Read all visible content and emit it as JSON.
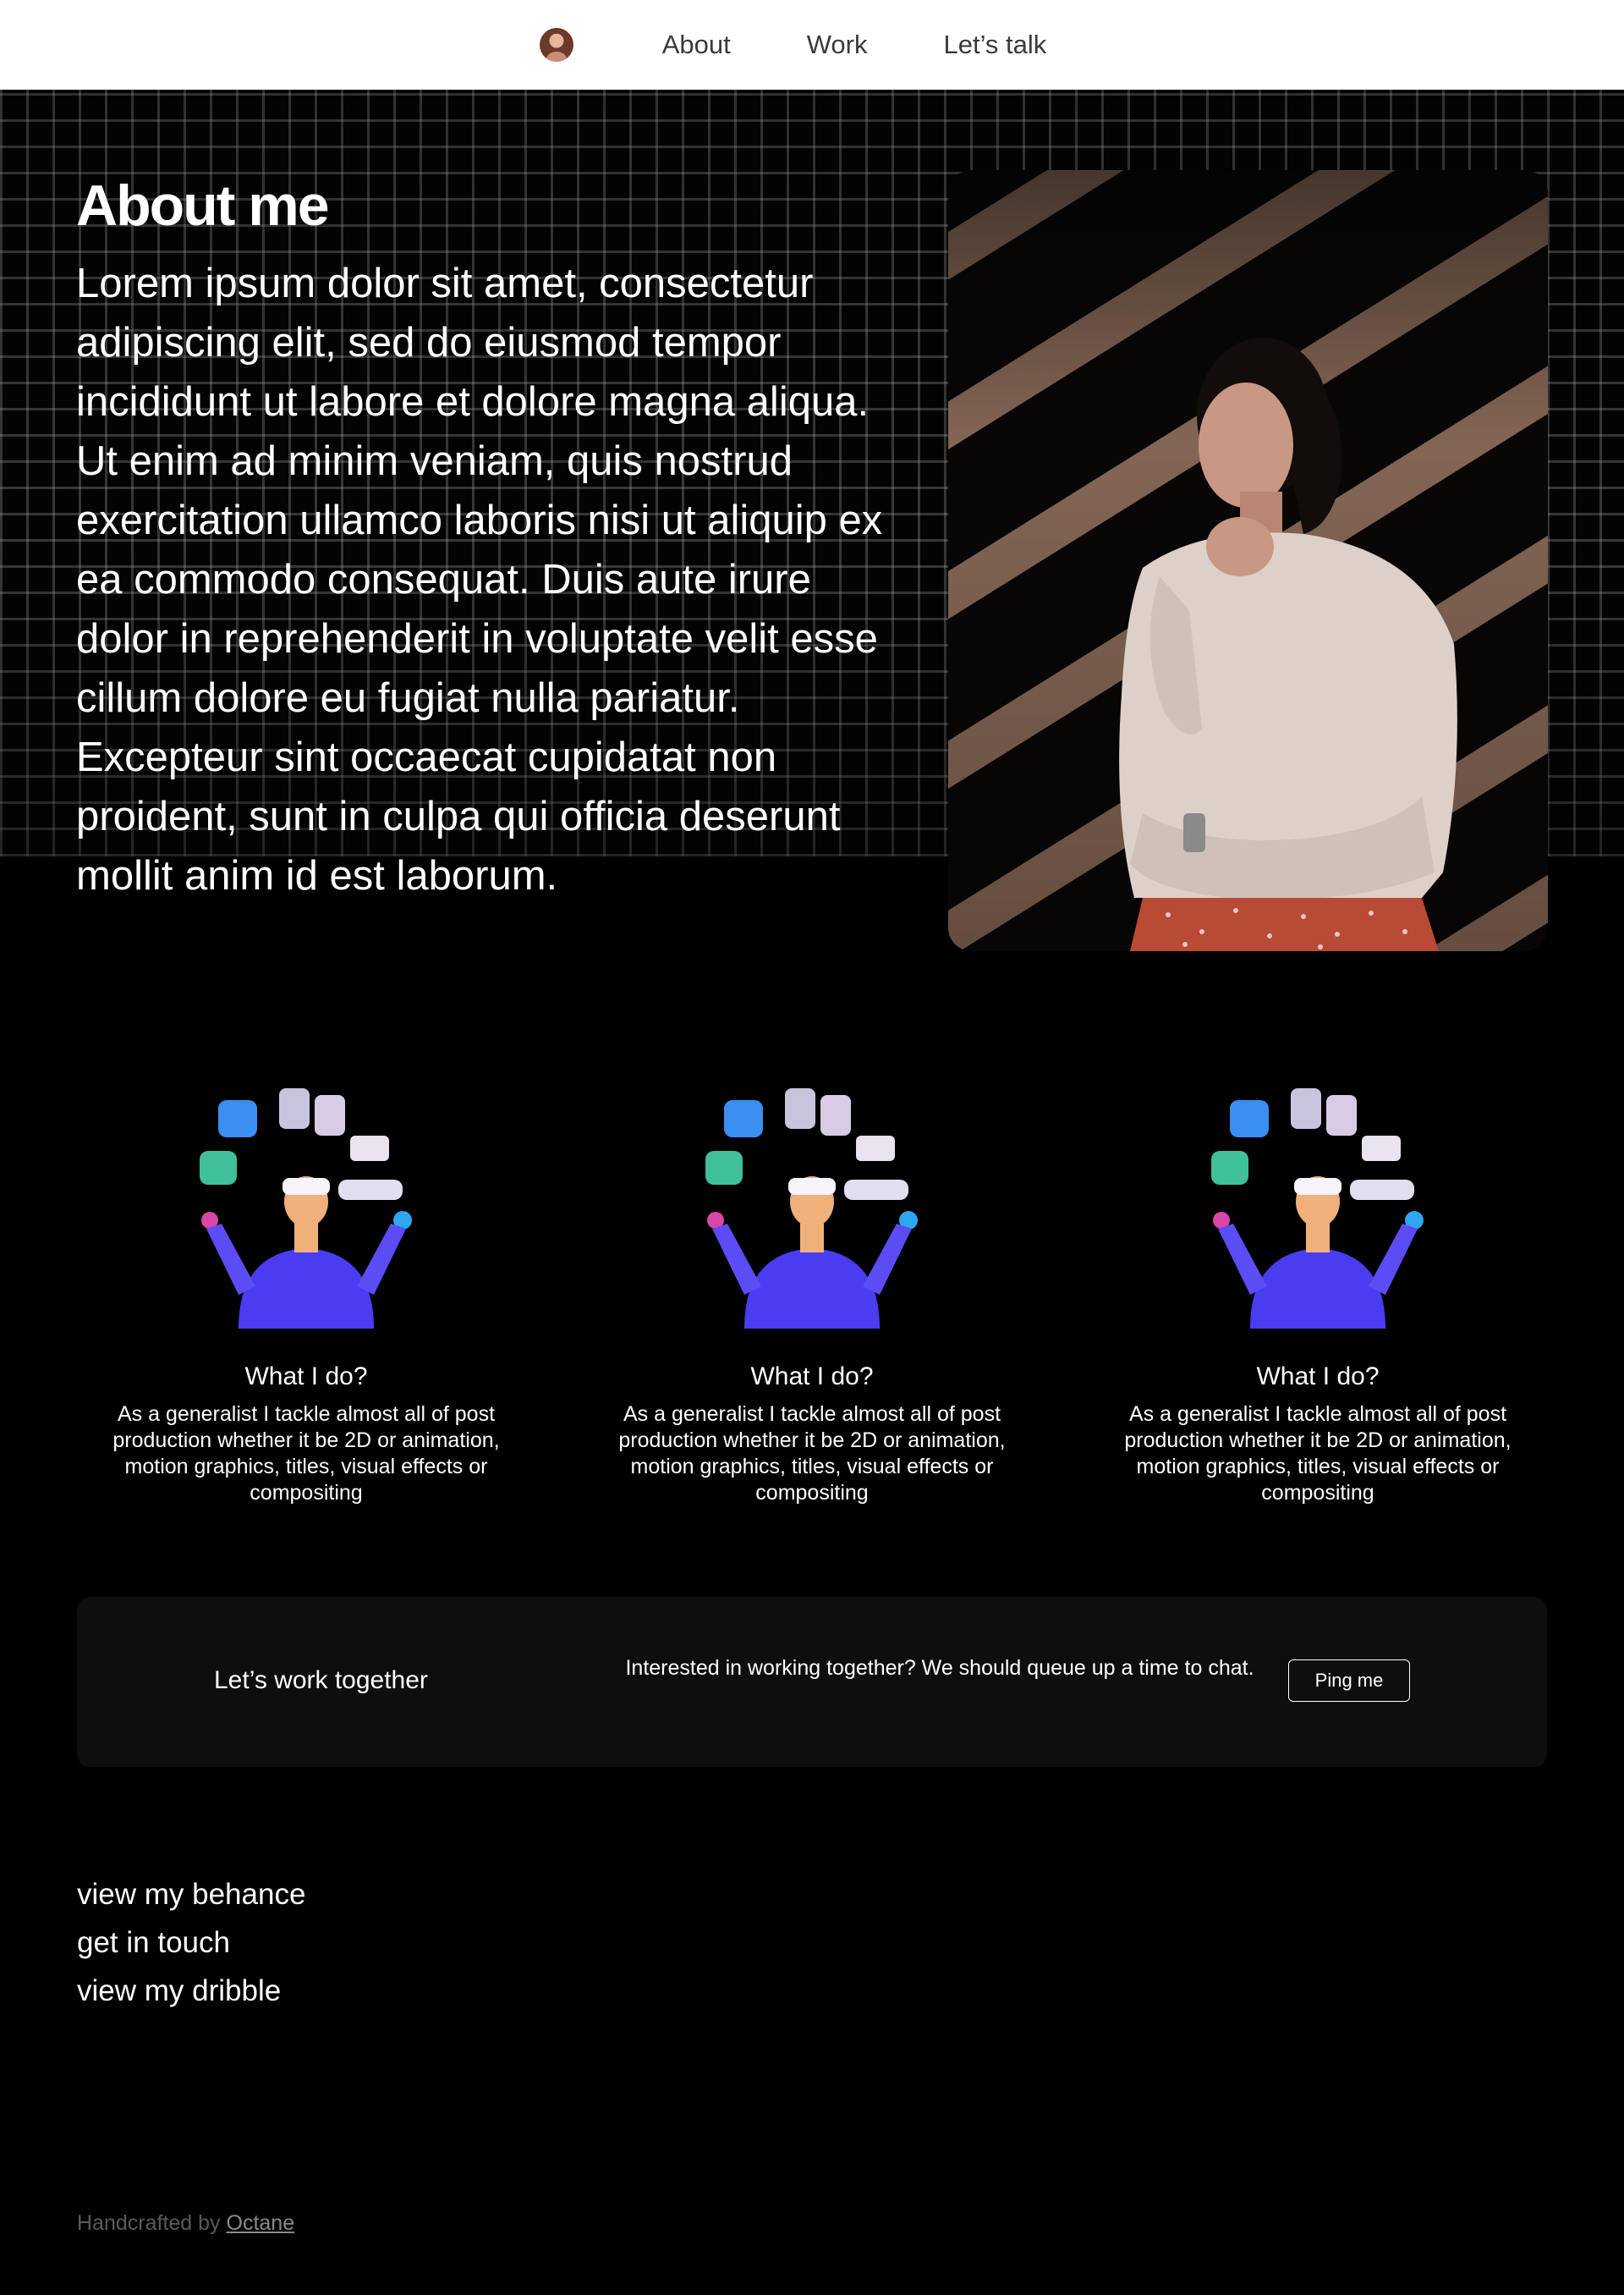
{
  "nav": {
    "links": [
      "About",
      "Work",
      "Let’s talk"
    ]
  },
  "about": {
    "title": "About me",
    "body": "Lorem ipsum dolor sit amet, consectetur adipiscing elit, sed do eiusmod tempor incididunt ut labore et dolore magna aliqua. Ut enim ad minim veniam, quis nostrud exercitation ullamco laboris nisi ut aliquip ex ea commodo consequat. Duis aute irure dolor in reprehenderit in voluptate velit esse cillum dolore eu fugiat nulla pariatur. Excepteur sint occaecat cupidatat non proident, sunt in culpa qui officia deserunt mollit anim id est laborum."
  },
  "services": [
    {
      "title": "What I do?",
      "desc": "As a generalist I tackle almost all of post production whether it be 2D or animation, motion graphics, titles, visual effects or compositing"
    },
    {
      "title": "What I do?",
      "desc": "As a generalist I tackle almost all of post production whether it be 2D or animation, motion graphics, titles, visual effects or compositing"
    },
    {
      "title": "What I do?",
      "desc": "As a generalist I tackle almost all of post production whether it be 2D or animation, motion graphics, titles, visual effects or compositing"
    }
  ],
  "cta": {
    "title": "Let’s work together",
    "text": "Interested in working together? We should queue up a time to chat.",
    "button": "Ping me"
  },
  "links": [
    "view my behance",
    "get in touch",
    "view my dribble"
  ],
  "footer": {
    "prefix": "Handcrafted by",
    "brand": "Octane"
  },
  "colors": {
    "nav_bg": "#ffffff",
    "page_bg": "#000000",
    "cta_bg": "#0e0e0e",
    "figure_blue": "#4a3cf0"
  }
}
